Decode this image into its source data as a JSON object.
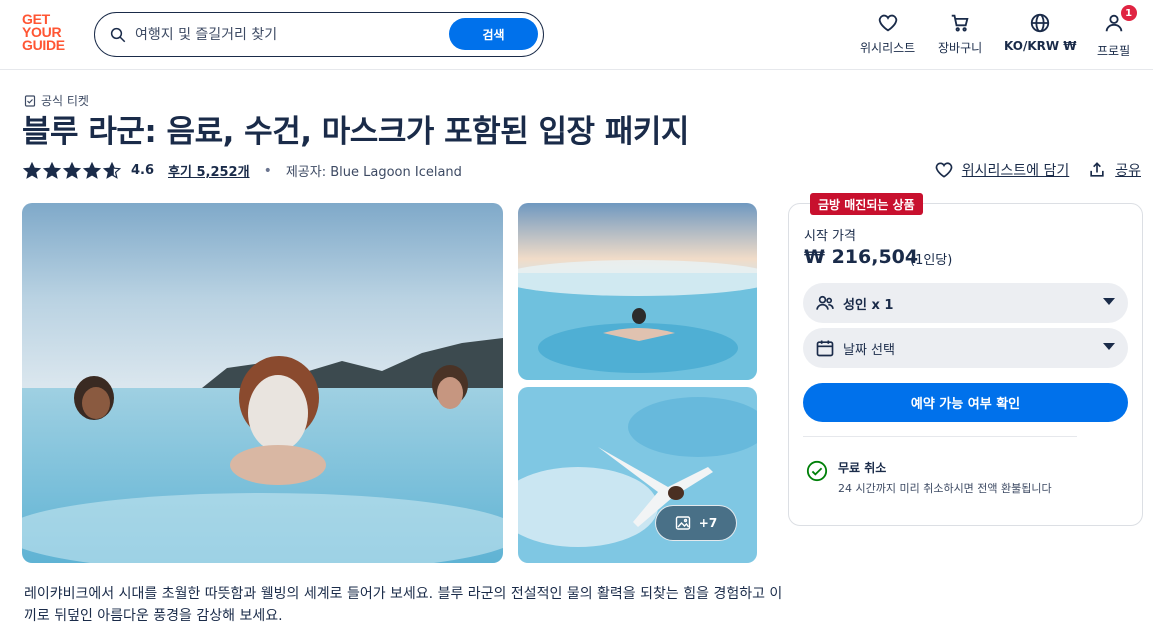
{
  "header": {
    "logo_lines": [
      "GET",
      "YOUR",
      "GUIDE"
    ],
    "search_placeholder": "여행지 및 즐길거리 찾기",
    "search_button": "검색",
    "nav": {
      "wishlist": "위시리스트",
      "cart": "장바구니",
      "currency": "KO/KRW ₩",
      "profile": "프로필",
      "profile_badge": "1"
    }
  },
  "product": {
    "tag": "공식 티켓",
    "title": "블루 라군: 음료, 수건, 마스크가 포함된 입장 패키지",
    "rating": "4.6",
    "rating_value": 4.6,
    "reviews": "후기 5,252개",
    "provider": "제공자: Blue Lagoon Iceland",
    "wishlist_action": "위시리스트에 담기",
    "share_action": "공유",
    "photos_more": "+7",
    "description": "레이캬비크에서 시대를 초월한 따뜻함과 웰빙의 세계로 들어가 보세요. 블루 라군의 전설적인 물의 활력을 되찾는 힘을 경험하고 이끼로 뒤덮인 아름다운 풍경을 감상해 보세요."
  },
  "booking": {
    "badge": "금방 매진되는 상품",
    "from_label": "시작 가격",
    "price": "₩ 216,504",
    "per": "(1인당)",
    "participants": "성인 x 1",
    "date": "날짜 선택",
    "check_button": "예약 가능 여부 확인",
    "cancel_title": "무료 취소",
    "cancel_desc": "24 시간까지 미리 취소하시면 전액 환불됩니다"
  },
  "colors": {
    "brand": "#ff5533",
    "primary_button": "#0071eb",
    "badge_red": "#c8102e",
    "text": "#1a2b49",
    "success": "#008009"
  }
}
